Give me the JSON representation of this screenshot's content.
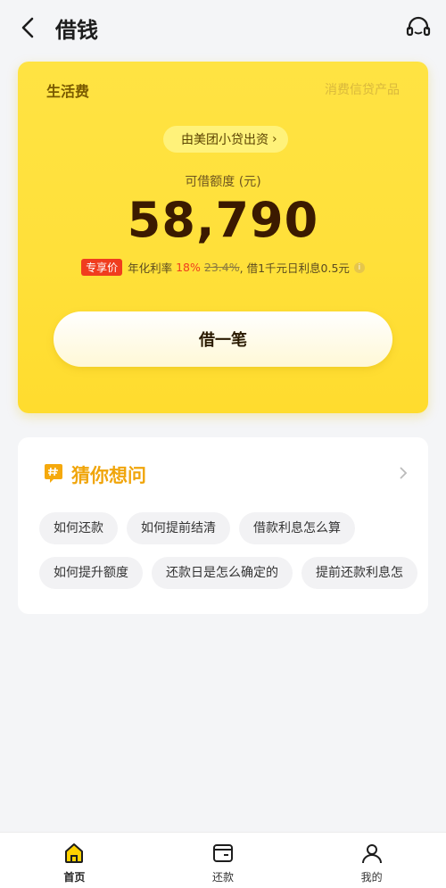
{
  "header": {
    "title": "借钱",
    "back_icon": "chevron-left-icon",
    "service_icon": "headset-icon"
  },
  "loan_card": {
    "product_name": "生活费",
    "product_type": "消费信贷产品",
    "lender": "由美团小贷出资",
    "quota_label": "可借额度 (元)",
    "amount": "58,790",
    "rate": {
      "badge": "专享价",
      "label": "年化利率",
      "value": "18%",
      "original": "23.4%",
      "suffix": ", 借1千元日利息0.5元"
    },
    "button_label": "借一笔",
    "colors": {
      "card": "#ffe03a",
      "badge": "#f03d1e"
    }
  },
  "faq": {
    "title": "猜你想问",
    "rows": [
      [
        "如何还款",
        "如何提前结清",
        "借款利息怎么算"
      ],
      [
        "如何提升额度",
        "还款日是怎么确定的",
        "提前还款利息怎"
      ]
    ]
  },
  "tabbar": {
    "items": [
      {
        "label": "首页",
        "icon": "home-icon",
        "active": true
      },
      {
        "label": "还款",
        "icon": "wallet-icon",
        "active": false
      },
      {
        "label": "我的",
        "icon": "user-icon",
        "active": false
      }
    ]
  }
}
